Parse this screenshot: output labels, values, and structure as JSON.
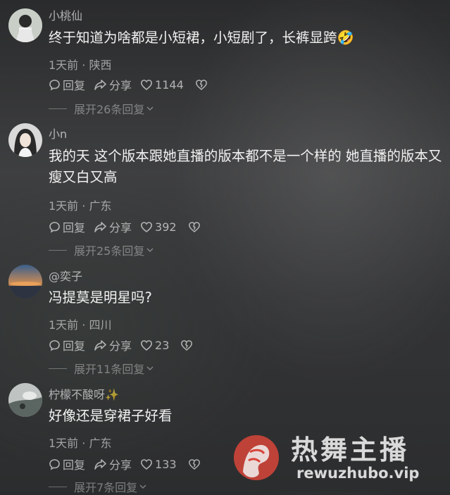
{
  "comments": [
    {
      "username": "小桃仙",
      "text": "终于知道为啥都是小短裙，小短剧了，长裤显跨🤣",
      "meta": "1天前 · 陕西",
      "reply_label": "回复",
      "share_label": "分享",
      "likes": "1144",
      "expand_label": "展开26条回复"
    },
    {
      "username": "小n",
      "text": "我的天 这个版本跟她直播的版本都不是一个样的 她直播的版本又瘦又白又高",
      "meta": "1天前 · 广东",
      "reply_label": "回复",
      "share_label": "分享",
      "likes": "392",
      "expand_label": "展开25条回复"
    },
    {
      "username": "@奕子",
      "text": "冯提莫是明星吗?",
      "meta": "1天前 · 四川",
      "reply_label": "回复",
      "share_label": "分享",
      "likes": "23",
      "expand_label": "展开11条回复"
    },
    {
      "username": "柠檬不酸呀✨",
      "text": "好像还是穿裙子好看",
      "meta": "1天前 · 广东",
      "reply_label": "回复",
      "share_label": "分享",
      "likes": "133",
      "expand_label": "展开7条回复"
    }
  ],
  "watermark": {
    "title": "热舞主播",
    "url": "rewuzhubo.vip",
    "accent": "#d8453a"
  },
  "icons": [
    "comment-bubble-icon",
    "share-arrow-icon",
    "heart-icon",
    "broken-heart-icon",
    "chevron-down-icon"
  ]
}
